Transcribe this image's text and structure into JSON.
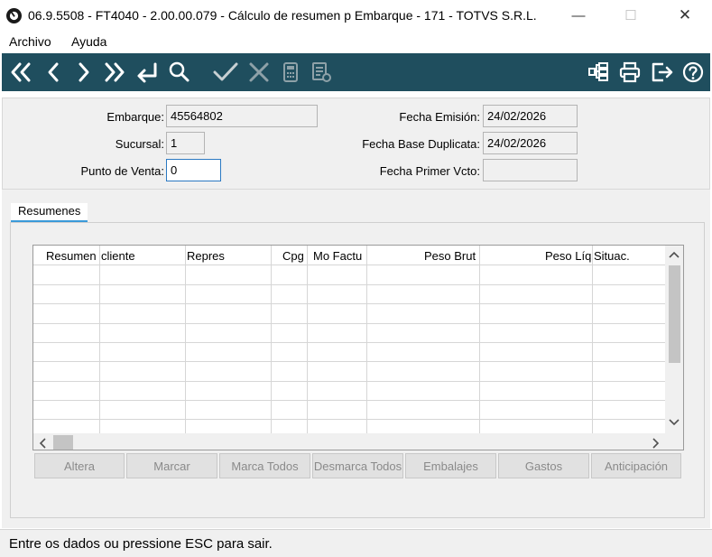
{
  "window": {
    "title": "06.9.5508 - FT4040 - 2.00.00.079 - Cálculo de resumen p Embarque - 171 - TOTVS S.R.L.",
    "minimize_glyph": "—",
    "maximize_glyph": "☐",
    "close_glyph": "✕"
  },
  "menu": {
    "items": [
      {
        "label": "Archivo"
      },
      {
        "label": "Ayuda"
      }
    ]
  },
  "toolbar": {
    "icon_color": "#ffffff",
    "background": "#1f4e5e",
    "left_icons": [
      "first-record-icon",
      "previous-record-icon",
      "next-record-icon",
      "last-record-icon",
      "return-icon",
      "search-icon",
      "confirm-check-icon",
      "cancel-x-icon",
      "calculator-icon",
      "document-settings-icon"
    ],
    "right_icons": [
      "structure-tree-icon",
      "print-icon",
      "exit-icon",
      "help-icon"
    ]
  },
  "form": {
    "embarque": {
      "label": "Embarque:",
      "value": "45564802"
    },
    "sucursal": {
      "label": "Sucursal:",
      "value": "1"
    },
    "punto_venta": {
      "label": "Punto de Venta:",
      "value": "0"
    },
    "fecha_emision": {
      "label": "Fecha Emisión:",
      "value": "24/02/2026"
    },
    "fecha_base_duplicata": {
      "label": "Fecha Base Duplicata:",
      "value": "24/02/2026"
    },
    "fecha_primer_vcto": {
      "label": "Fecha Primer Vcto:",
      "value": ""
    }
  },
  "tabs": [
    {
      "label": "Resumenes"
    }
  ],
  "grid": {
    "columns": [
      "Resumen",
      "cliente",
      "Repres",
      "Cpg",
      "Mo Factu",
      "Peso Brut",
      "Peso Líq",
      "Situac."
    ],
    "rows": []
  },
  "buttons": {
    "altera": "Altera",
    "marcar": "Marcar",
    "marca_todos": "Marca Todos",
    "desmarca_todos": "Desmarca Todos",
    "embalajes": "Embalajes",
    "gastos": "Gastos",
    "anticipacion": "Anticipación"
  },
  "status": {
    "text": "Entre os dados ou pressione ESC para sair."
  }
}
